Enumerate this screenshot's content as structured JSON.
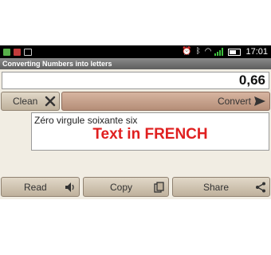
{
  "statusbar": {
    "time": "17:01"
  },
  "app": {
    "title": "Converting Numbers into letters"
  },
  "input": {
    "value": "0,66"
  },
  "buttons": {
    "clean": "Clean",
    "convert": "Convert",
    "read": "Read",
    "copy": "Copy",
    "share": "Share"
  },
  "result": {
    "text": "Zéro virgule soixante six",
    "overlay": "Text in FRENCH"
  },
  "icons": {
    "clean": "close-icon",
    "convert": "send-arrow-icon",
    "read": "speaker-icon",
    "copy": "copy-icon",
    "share": "share-icon"
  },
  "colors": {
    "overlay": "#e02020",
    "convert_button": "#c8a08a"
  }
}
